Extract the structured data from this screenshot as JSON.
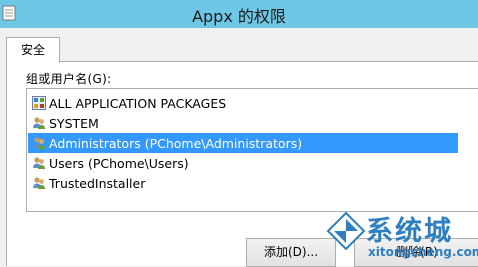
{
  "window": {
    "title": "Appx 的权限"
  },
  "tabs": [
    {
      "label": "安全"
    }
  ],
  "security": {
    "group_label": "组或用户名(G):",
    "principals": [
      {
        "label": "ALL APPLICATION PACKAGES",
        "icon": "app-packages-icon",
        "selected": false
      },
      {
        "label": "SYSTEM",
        "icon": "users-icon",
        "selected": false
      },
      {
        "label": "Administrators (PChome\\Administrators)",
        "icon": "users-icon",
        "selected": true
      },
      {
        "label": "Users (PChome\\Users)",
        "icon": "users-icon",
        "selected": false
      },
      {
        "label": "TrustedInstaller",
        "icon": "users-icon",
        "selected": false
      }
    ],
    "add_label": "添加(D)...",
    "remove_label": "删除(R)"
  },
  "watermark": {
    "text": "系统城",
    "url": "xitongcheng.com"
  },
  "colors": {
    "titlebar": "#6fc7e6",
    "selection": "#3399ff",
    "watermark": "#2d7fc0"
  }
}
